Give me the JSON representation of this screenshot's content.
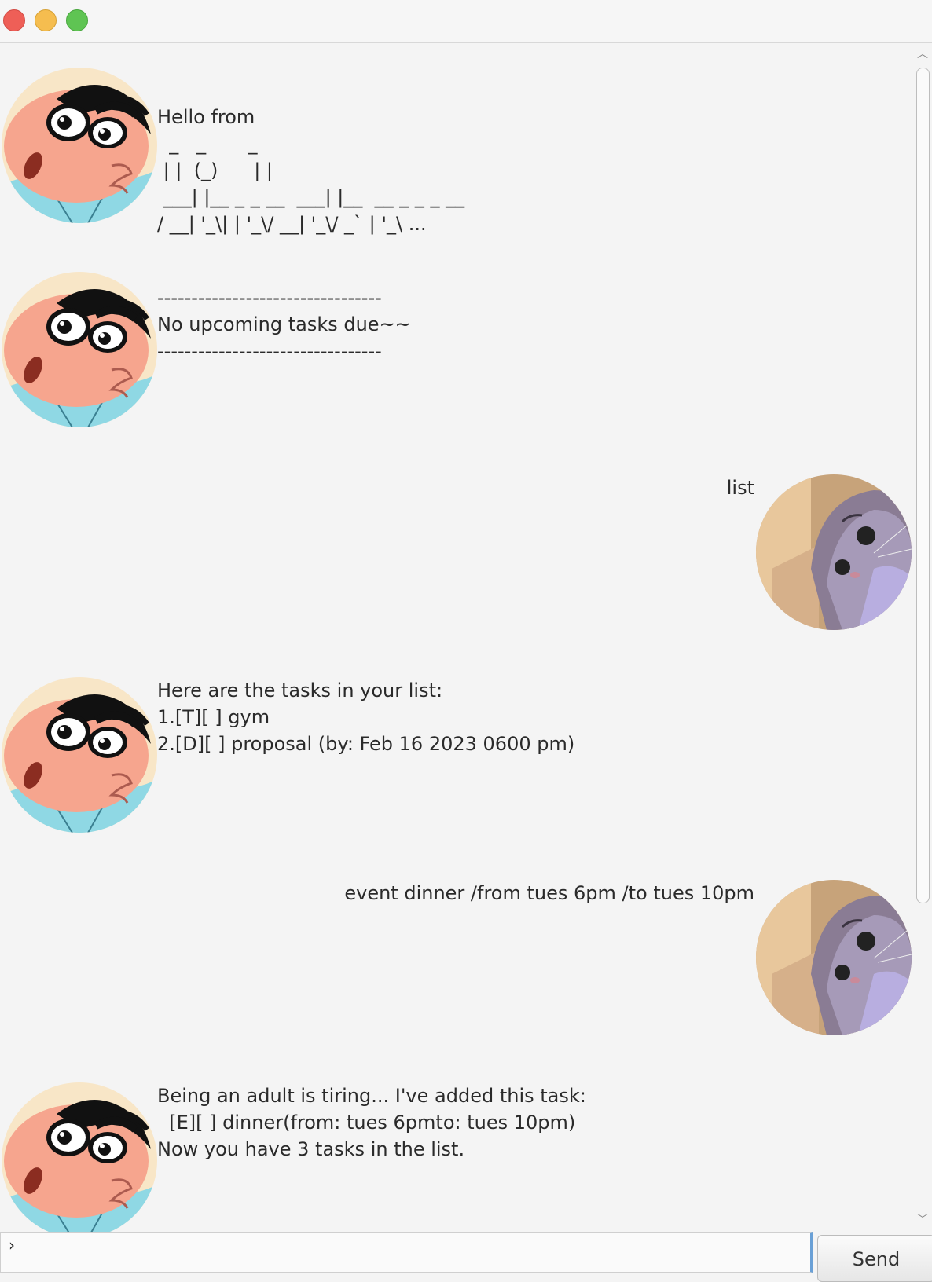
{
  "window": {
    "controls": [
      "close",
      "minimize",
      "maximize"
    ]
  },
  "messages": [
    {
      "sender": "bot",
      "avatar": "shinchan-avatar",
      "text": "Hello from\n  _   _       _\n | |  (_)      | |\n ___| |__ _ _ __  ___| |__  __ _ _ _ __\n/ __| '_\\| | '_\\/ __| '_\\/ _` | '_\\ ..."
    },
    {
      "sender": "bot",
      "avatar": "shinchan-avatar",
      "text": "---------------------------------\nNo upcoming tasks due~~\n---------------------------------"
    },
    {
      "sender": "user",
      "avatar": "cat-avatar",
      "text": "list"
    },
    {
      "sender": "bot",
      "avatar": "shinchan-avatar",
      "text": "Here are the tasks in your list:\n1.[T][ ] gym\n2.[D][ ] proposal (by: Feb 16 2023 0600 pm)"
    },
    {
      "sender": "user",
      "avatar": "cat-avatar",
      "text": "event dinner /from tues 6pm /to tues 10pm"
    },
    {
      "sender": "bot",
      "avatar": "shinchan-avatar",
      "text": "Being an adult is tiring... I've added this task:\n  [E][ ] dinner(from: tues 6pmto: tues 10pm)\nNow you have 3 tasks in the list."
    }
  ],
  "input": {
    "value": "›"
  },
  "send_button": {
    "label": "Send"
  },
  "colors": {
    "background": "#f4f4f4",
    "close": "#ee5f57",
    "minimize": "#f5bd4f",
    "maximize": "#5fc453",
    "bot_avatar_bg": "#f6dfb8",
    "user_avatar_bg": "#c8a27a"
  }
}
